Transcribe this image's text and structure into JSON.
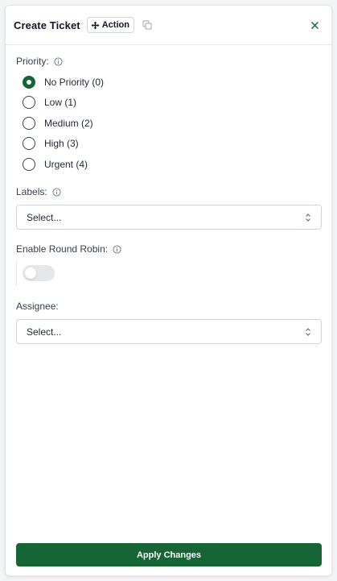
{
  "header": {
    "title": "Create Ticket",
    "badge": {
      "label": "Action",
      "icon": "move-icon"
    },
    "copy_icon": "copy-icon",
    "close_icon": "close-icon"
  },
  "priority": {
    "label": "Priority:",
    "info_icon": "info-icon",
    "selected": "No Priority (0)",
    "options": [
      {
        "label": "No Priority (0)",
        "checked": true
      },
      {
        "label": "Low (1)",
        "checked": false
      },
      {
        "label": "Medium (2)",
        "checked": false
      },
      {
        "label": "High (3)",
        "checked": false
      },
      {
        "label": "Urgent (4)",
        "checked": false
      }
    ]
  },
  "labels": {
    "label": "Labels:",
    "info_icon": "info-icon",
    "value": "Select..."
  },
  "round_robin": {
    "label": "Enable Round Robin:",
    "info_icon": "info-icon",
    "enabled": false
  },
  "assignee": {
    "label": "Assignee:",
    "value": "Select..."
  },
  "footer": {
    "apply_label": "Apply Changes"
  },
  "colors": {
    "accent": "#166534",
    "border": "#e5e7eb",
    "toggle_off": "#e5e7eb"
  }
}
